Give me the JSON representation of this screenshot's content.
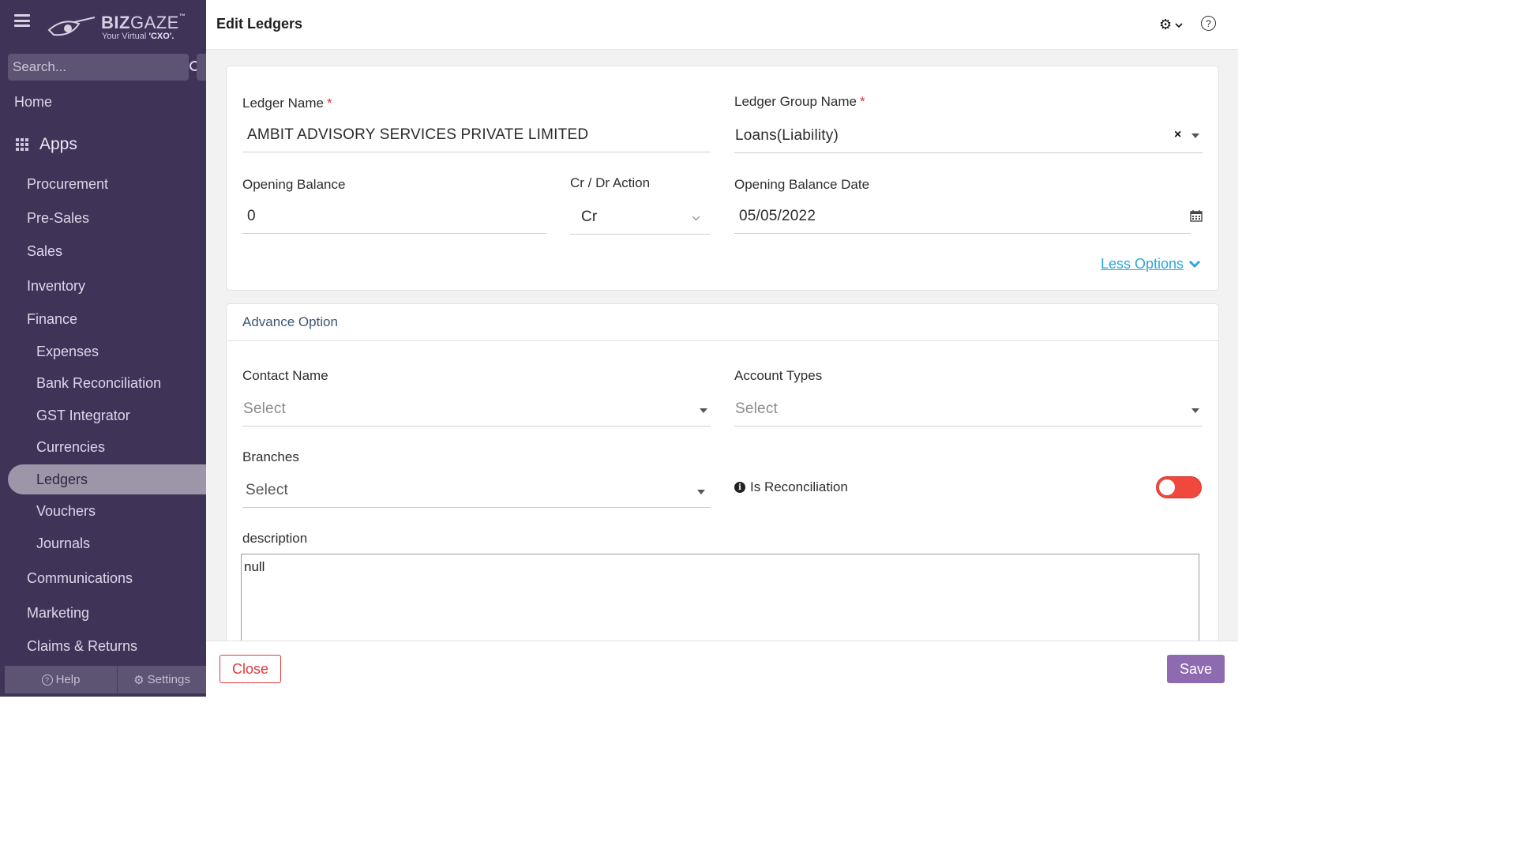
{
  "brand": {
    "name_bold": "BIZ",
    "name_light": "GAZE",
    "tm": "™",
    "tagline_prefix": "Your Virtual ",
    "tagline_strong": "'CXO'."
  },
  "search": {
    "placeholder": "Search..."
  },
  "sidebar": {
    "home": "Home",
    "apps": "Apps",
    "items": [
      "Procurement",
      "Pre-Sales",
      "Sales",
      "Inventory",
      "Finance"
    ],
    "finance_sub": [
      "Expenses",
      "Bank Reconciliation",
      "GST Integrator",
      "Currencies",
      "Ledgers",
      "Vouchers",
      "Journals"
    ],
    "more": [
      "Communications",
      "Marketing",
      "Claims & Returns"
    ],
    "footer": {
      "help": "Help",
      "settings": "Settings"
    }
  },
  "header": {
    "title": "Edit Ledgers",
    "help_glyph": "?"
  },
  "form": {
    "ledger_name": {
      "label": "Ledger Name",
      "required": "*",
      "value": "AMBIT ADVISORY SERVICES PRIVATE LIMITED"
    },
    "ledger_group": {
      "label": "Ledger Group Name",
      "required": "*",
      "value": "Loans(Liability)"
    },
    "opening_balance": {
      "label": "Opening Balance",
      "value": "0"
    },
    "cr_dr": {
      "label": "Cr / Dr Action",
      "value": "Cr"
    },
    "opening_date": {
      "label": "Opening Balance Date",
      "value": "05/05/2022"
    },
    "less_options": "Less Options"
  },
  "advance": {
    "title": "Advance Option",
    "contact": {
      "label": "Contact Name",
      "placeholder": "Select"
    },
    "account_types": {
      "label": "Account Types",
      "placeholder": "Select"
    },
    "branches": {
      "label": "Branches",
      "placeholder": "Select"
    },
    "reconciliation": {
      "label": "Is Reconciliation",
      "enabled": false,
      "toggle_color": "#f1483d"
    },
    "description": {
      "label": "description",
      "value": "null"
    }
  },
  "actions": {
    "close": "Close",
    "save": "Save"
  },
  "colors": {
    "sidebar": "#3f3458",
    "accent": "#8e6bb0",
    "link": "#2fa6da",
    "danger": "#e03a3a"
  }
}
